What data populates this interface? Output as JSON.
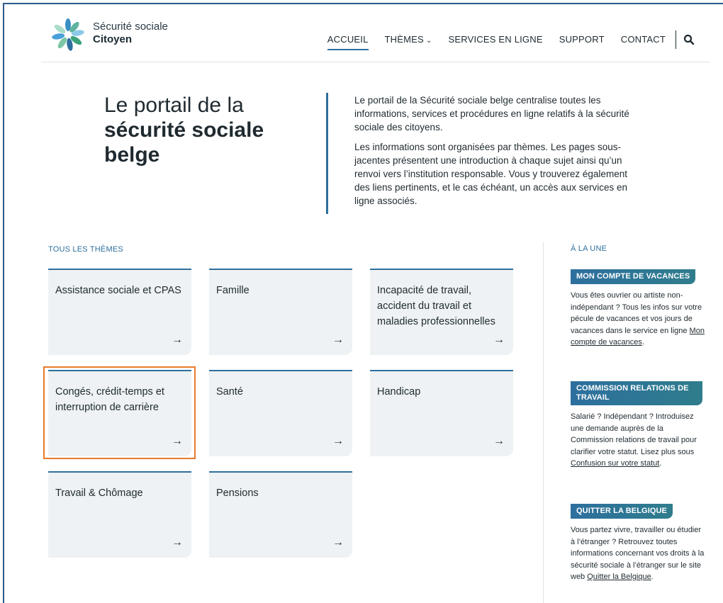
{
  "header": {
    "brand_line1": "Sécurité sociale",
    "brand_line2": "Citoyen",
    "nav": [
      {
        "label": "ACCUEIL",
        "active": true
      },
      {
        "label": "THÈMES",
        "active": false
      },
      {
        "label": "SERVICES EN LIGNE",
        "active": false
      },
      {
        "label": "SUPPORT",
        "active": false
      },
      {
        "label": "CONTACT",
        "active": false
      }
    ]
  },
  "hero": {
    "title_line1": "Le portail de la",
    "title_line2": "sécurité sociale",
    "title_line3": "belge",
    "paragraph1": "Le portail de la Sécurité sociale belge centralise toutes les informations, services et procédures en ligne relatifs à la sécurité sociale des citoyens.",
    "paragraph2": "Les informations sont organisées par thèmes. Les pages sous-jacentes présentent une introduction à chaque sujet ainsi qu’un renvoi vers l’institution responsable. Vous y trouverez également des liens pertinents, et le cas échéant, un accès aux services en ligne associés."
  },
  "themes": {
    "label": "TOUS LES THÈMES",
    "cards": [
      "Assistance sociale et CPAS",
      "Famille",
      "Incapacité de travail, accident du travail et maladies professionnelles",
      "Congés, crédit-temps et interruption de carrière",
      "Santé",
      "Handicap",
      "Travail & Chômage",
      "Pensions"
    ],
    "arrow": "→"
  },
  "sidebar": {
    "label": "À LA UNE",
    "items": [
      {
        "badge": "MON COMPTE DE VACANCES",
        "text": "Vous êtes ouvrier ou artiste non-indépendant ? Tous les infos sur votre pécule de vacances et vos jours de vacances dans le service en ligne ",
        "link": "Mon compte de vacances",
        "after": "."
      },
      {
        "badge": "COMMISSION RELATIONS DE TRAVAIL",
        "text": "Salarié ? Indépendant ? Introduisez une demande auprès de la Commission relations de travail pour clarifier votre statut. Lisez plus sous ",
        "link": "Confusion sur votre statut",
        "after": "."
      },
      {
        "badge": "QUITTER LA BELGIQUE",
        "text": "Vous partez vivre, travailler ou étudier à l’étranger ? Retrouvez toutes informations concernant vos droits à la sécurité sociale à l’étranger sur le site web ",
        "link": "Quitter la Belgique",
        "after": "."
      }
    ]
  },
  "colors": {
    "accent": "#2e6f9e",
    "highlight": "#e87a2a",
    "card_bg": "#eef2f4"
  },
  "icons": {
    "search": "search-icon",
    "logo": "flower-logo-icon",
    "arrow": "arrow-right-icon",
    "chevron": "chevron-down-icon"
  }
}
